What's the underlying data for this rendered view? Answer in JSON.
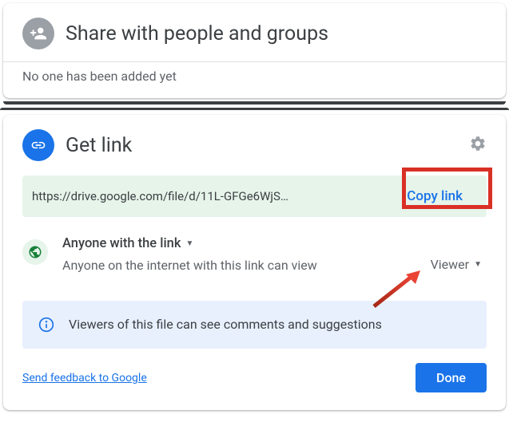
{
  "share": {
    "title": "Share with people and groups",
    "subtitle": "No one has been added yet"
  },
  "getlink": {
    "title": "Get link",
    "url": "https://drive.google.com/file/d/11L-GFGe6WjS…",
    "copy_label": "Copy link",
    "access": {
      "title": "Anyone with the link",
      "desc": "Anyone on the internet with this link can view",
      "role": "Viewer"
    },
    "info": "Viewers of this file can see comments and suggestions",
    "feedback": "Send feedback to Google",
    "done": "Done"
  }
}
